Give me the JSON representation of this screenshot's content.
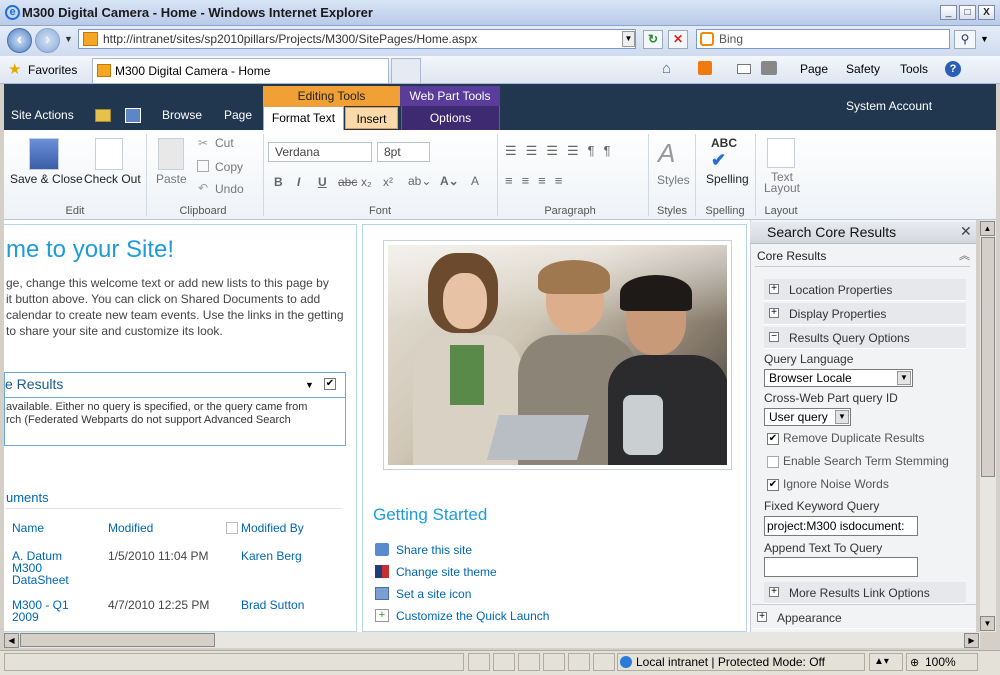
{
  "window": {
    "title": "M300 Digital Camera - Home - Windows Internet Explorer",
    "min": "_",
    "max": "□",
    "close": "X"
  },
  "address": {
    "url": "http://intranet/sites/sp2010pillars/Projects/M300/SitePages/Home.aspx",
    "search_placeholder": "Bing"
  },
  "favorites": {
    "label": "Favorites",
    "tab_title": "M300 Digital Camera - Home"
  },
  "commands": {
    "page": "Page",
    "safety": "Safety",
    "tools": "Tools"
  },
  "ribbon": {
    "site_actions": "Site Actions",
    "browse": "Browse",
    "page": "Page",
    "editing_tools": "Editing Tools",
    "web_part_tools": "Web Part Tools",
    "format_text": "Format Text",
    "insert": "Insert",
    "options": "Options",
    "user": "System Account",
    "save_close": "Save & Close",
    "check_out": "Check Out",
    "paste": "Paste",
    "cut": "Cut",
    "copy": "Copy",
    "undo": "Undo",
    "font": "Verdana",
    "size": "8pt",
    "styles": "Styles",
    "spelling": "Spelling",
    "text_layout": "Text Layout",
    "groups": {
      "edit": "Edit",
      "clipboard": "Clipboard",
      "font": "Font",
      "paragraph": "Paragraph",
      "styles": "Styles",
      "spelling": "Spelling",
      "layout": "Layout"
    }
  },
  "main": {
    "welcome": "me to your Site!",
    "welcome_lines": [
      "ge, change this welcome text or add new lists to this page by",
      "it button above. You can click on Shared Documents to add",
      "calendar to create new team events. Use the links in the getting",
      "to share your site and customize its look."
    ],
    "core_results_title": "e Results",
    "core_results_msg1": "available. Either no query is specified, or the query came from",
    "core_results_msg2": "rch (Federated Webparts do not support Advanced Search",
    "documents_title": "uments",
    "columns": {
      "name": "Name",
      "modified": "Modified",
      "modified_by": "Modified By"
    },
    "rows": [
      {
        "name1": "A. Datum",
        "name2": "M300",
        "name3": "DataSheet",
        "modified": "1/5/2010 11:04 PM",
        "by": "Karen Berg"
      },
      {
        "name1": "M300 - Q1",
        "name2": "2009",
        "name3": "",
        "modified": "4/7/2010 12:25 PM",
        "by": "Brad Sutton"
      }
    ],
    "getting_started": "Getting Started",
    "links": [
      "Share this site",
      "Change site theme",
      "Set a site icon",
      "Customize the Quick Launch"
    ]
  },
  "panel": {
    "title": "Search Core Results",
    "section": "Core Results",
    "location": "Location Properties",
    "display": "Display Properties",
    "results_query": "Results Query Options",
    "query_language_label": "Query Language",
    "query_language": "Browser Locale",
    "cross_label": "Cross-Web Part query ID",
    "cross_value": "User query",
    "remove_dup": "Remove Duplicate Results",
    "stemming": "Enable Search Term Stemming",
    "noise": "Ignore Noise Words",
    "fixed_label": "Fixed Keyword Query",
    "fixed_value": "project:M300 isdocument:",
    "append_label": "Append Text To Query",
    "append_value": "",
    "more_link": "More Results Link Options",
    "appearance": "Appearance"
  },
  "status": {
    "zone": "Local intranet | Protected Mode: Off",
    "zoom": "100%"
  }
}
